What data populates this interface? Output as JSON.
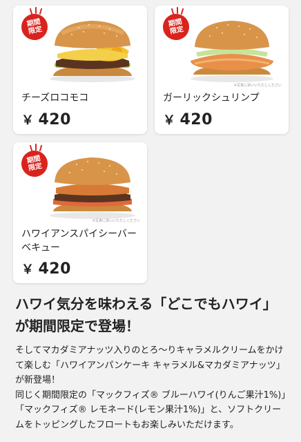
{
  "products": [
    {
      "badge": "期間\n限定",
      "name": "チーズロコモコ",
      "price_symbol": "￥",
      "price": "420"
    },
    {
      "badge": "期間\n限定",
      "name": "ガーリックシュリンプ",
      "price_symbol": "￥",
      "price": "420",
      "note": "※写真に添いいただしください"
    },
    {
      "badge": "期間\n限定",
      "name": "ハワイアンスパイシーバーベキュー",
      "price_symbol": "￥",
      "price": "420",
      "note": "※写真に添いいただしください"
    }
  ],
  "headline": "ハワイ気分を味わえる「どこでもハワイ」が期間限定で登場！",
  "body": "そしてマカダミアナッツ入りのとろ〜りキャラメルクリームをかけて楽しむ「ハワイアンパンケーキ キャラメル&マカダミアナッツ」が新登場！\n同じく期間限定の「マックフィズ® ブルーハワイ(りんご果汁1%)」「マックフィズ® レモネード(レモン果汁1%)」と、ソフトクリームをトッピングしたフロートもお楽しみいただけます。",
  "colors": {
    "badge": "#d9231d",
    "background": "#f2f2f2",
    "card": "#ffffff"
  }
}
